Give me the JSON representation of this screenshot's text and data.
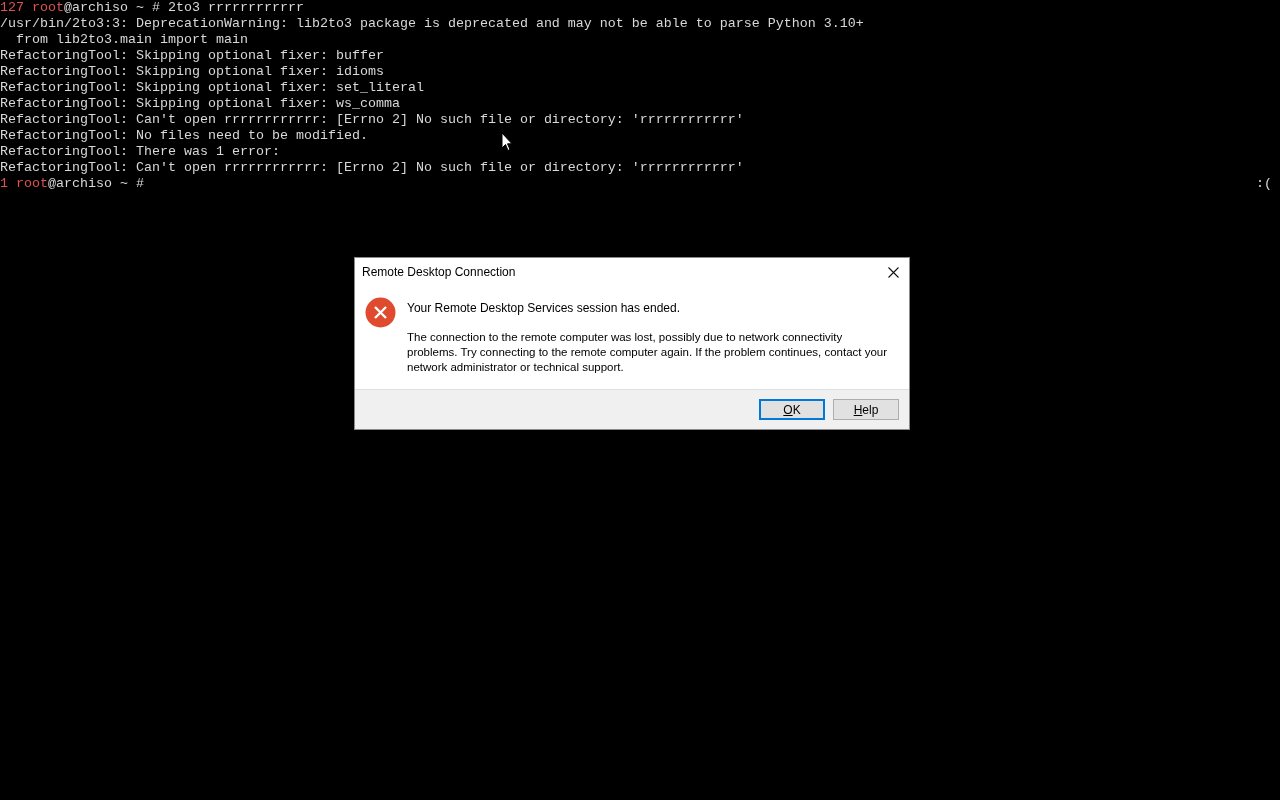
{
  "terminal": {
    "lines": [
      {
        "segments": [
          {
            "text": "127 root",
            "kind": "alert"
          },
          {
            "text": "@archiso ~ # 2to3 rrrrrrrrrrrr",
            "kind": "plain"
          }
        ]
      },
      {
        "segments": [
          {
            "text": "/usr/bin/2to3:3: DeprecationWarning: lib2to3 package is deprecated and may not be able to parse Python 3.10+",
            "kind": "plain"
          }
        ]
      },
      {
        "segments": [
          {
            "text": "  from lib2to3.main import main",
            "kind": "plain"
          }
        ]
      },
      {
        "segments": [
          {
            "text": "RefactoringTool: Skipping optional fixer: buffer",
            "kind": "plain"
          }
        ]
      },
      {
        "segments": [
          {
            "text": "RefactoringTool: Skipping optional fixer: idioms",
            "kind": "plain"
          }
        ]
      },
      {
        "segments": [
          {
            "text": "RefactoringTool: Skipping optional fixer: set_literal",
            "kind": "plain"
          }
        ]
      },
      {
        "segments": [
          {
            "text": "RefactoringTool: Skipping optional fixer: ws_comma",
            "kind": "plain"
          }
        ]
      },
      {
        "segments": [
          {
            "text": "RefactoringTool: Can't open rrrrrrrrrrrr: [Errno 2] No such file or directory: 'rrrrrrrrrrrr'",
            "kind": "plain"
          }
        ]
      },
      {
        "segments": [
          {
            "text": "RefactoringTool: No files need to be modified.",
            "kind": "plain"
          }
        ]
      },
      {
        "segments": [
          {
            "text": "RefactoringTool: There was 1 error:",
            "kind": "plain"
          }
        ]
      },
      {
        "segments": [
          {
            "text": "RefactoringTool: Can't open rrrrrrrrrrrr: [Errno 2] No such file or directory: 'rrrrrrrrrrrr'",
            "kind": "plain"
          }
        ]
      },
      {
        "segments": [
          {
            "text": "1 root",
            "kind": "alert"
          },
          {
            "text": "@archiso ~ #",
            "kind": "plain"
          }
        ],
        "right_prompt": ":("
      }
    ]
  },
  "dialog": {
    "title": "Remote Desktop Connection",
    "heading": "Your Remote Desktop Services session has ended.",
    "message": "The connection to the remote computer was lost, possibly due to network connectivity problems. Try connecting to the remote computer again. If the problem continues, contact your network administrator or technical support.",
    "buttons": [
      {
        "label": "OK",
        "default": true
      },
      {
        "label": "Help",
        "default": false
      }
    ]
  }
}
